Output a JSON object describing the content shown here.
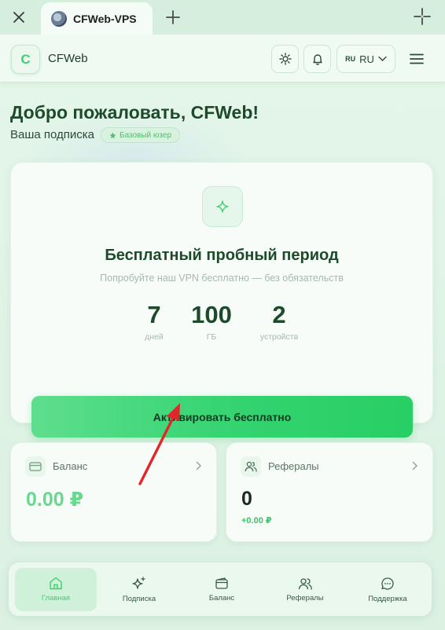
{
  "browser": {
    "tab_title": "CFWeb-VPS"
  },
  "header": {
    "logo_letter": "C",
    "app_name": "CFWeb",
    "lang_small": "RU",
    "lang_code": "RU"
  },
  "welcome": {
    "title": "Добро пожаловать, CFWeb!",
    "subscription_label": "Ваша подписка",
    "badge": "Базовый юзер"
  },
  "trial": {
    "title": "Бесплатный пробный период",
    "subtitle": "Попробуйте наш VPN бесплатно — без обязательств",
    "stats": [
      {
        "value": "7",
        "unit": "дней"
      },
      {
        "value": "100",
        "unit": "ГБ"
      },
      {
        "value": "2",
        "unit": "устройств"
      }
    ],
    "button_label": "Активировать бесплатно"
  },
  "balance_card": {
    "title": "Баланс",
    "value": "0.00 ₽"
  },
  "referral_card": {
    "title": "Рефералы",
    "value": "0",
    "earned": "+0.00 ₽"
  },
  "nav": {
    "items": [
      {
        "label": "Главная",
        "icon": "home-icon",
        "active": true
      },
      {
        "label": "Подписка",
        "icon": "sparkles-icon",
        "active": false
      },
      {
        "label": "Баланс",
        "icon": "wallet-icon",
        "active": false
      },
      {
        "label": "Рефералы",
        "icon": "users-icon",
        "active": false
      },
      {
        "label": "Поддержка",
        "icon": "chat-icon",
        "active": false
      }
    ]
  },
  "colors": {
    "accent": "#3fcf6f",
    "button_start": "#5ede8d",
    "button_end": "#28cf64",
    "annotation_arrow": "#e3262a"
  }
}
